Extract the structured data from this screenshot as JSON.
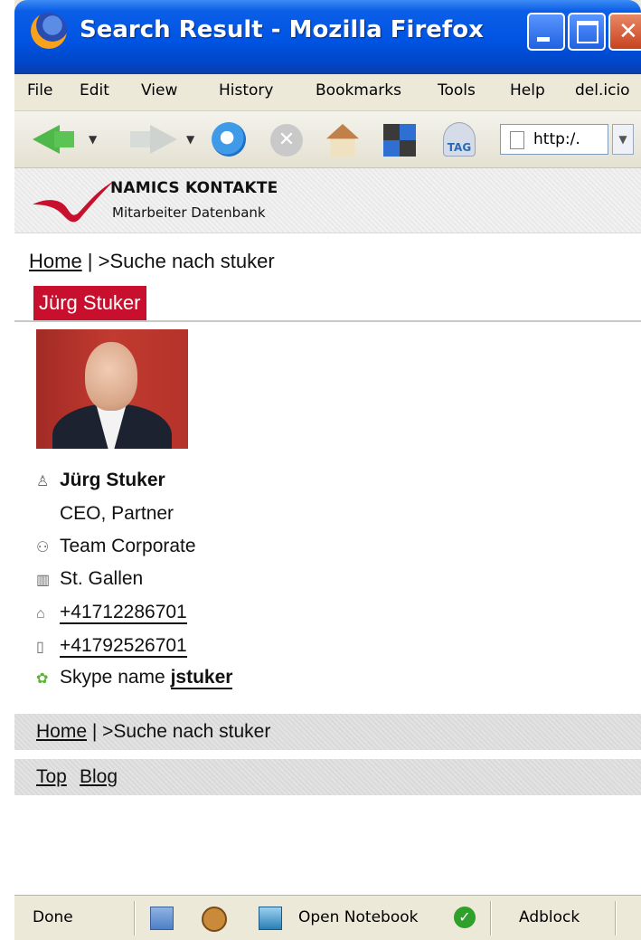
{
  "window": {
    "title": "Search Result - Mozilla Firefox"
  },
  "menu": [
    "File",
    "Edit",
    "View",
    "History",
    "Bookmarks",
    "Tools",
    "Help",
    "del.icio"
  ],
  "toolbar": {
    "tag_label": "TAG",
    "url_text": "http:/."
  },
  "brand": {
    "name": "NAMICS KONTAKTE",
    "subtitle": "Mitarbeiter Datenbank",
    "accent": "#c8102e"
  },
  "breadcrumb": {
    "home": "Home",
    "separator": " | ",
    "current": ">Suche nach stuker"
  },
  "person": {
    "tab_name": "Jürg Stuker",
    "name": "Jürg Stuker",
    "role": "CEO, Partner",
    "team": "Team Corporate",
    "location": "St. Gallen",
    "phone": "+41712286701",
    "mobile": "+41792526701",
    "skype_label": "Skype name ",
    "skype_id": "jstuker"
  },
  "footer": {
    "top": "Top",
    "blog": "Blog"
  },
  "status": {
    "done": "Done",
    "notebook": "Open Notebook",
    "adblock": "Adblock"
  }
}
